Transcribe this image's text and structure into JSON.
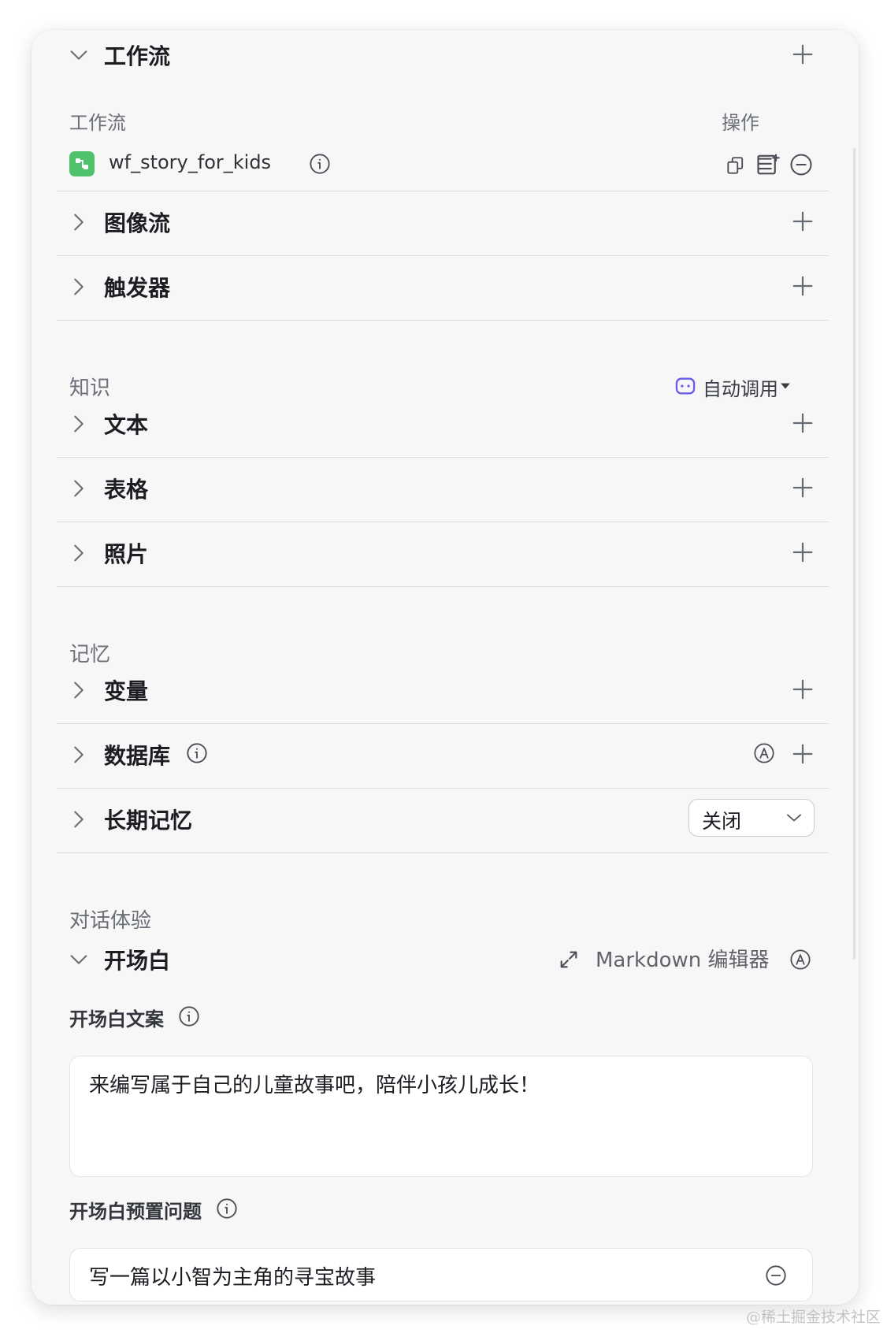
{
  "workflow": {
    "title": "工作流",
    "col_workflow": "工作流",
    "col_actions": "操作",
    "item_name": "wf_story_for_kids"
  },
  "image_flow": {
    "title": "图像流"
  },
  "trigger": {
    "title": "触发器"
  },
  "knowledge": {
    "label": "知识",
    "auto_call": "自动调用",
    "text": "文本",
    "table": "表格",
    "photo": "照片"
  },
  "memory": {
    "label": "记忆",
    "variable": "变量",
    "database": "数据库",
    "long_term": "长期记忆",
    "long_term_value": "关闭"
  },
  "dialog": {
    "label": "对话体验",
    "opening": "开场白",
    "markdown_editor": "Markdown 编辑器",
    "opening_text_label": "开场白文案",
    "opening_text": "来编写属于自己的儿童故事吧，陪伴小孩儿成长！",
    "preset_label": "开场白预置问题",
    "preset_question": "写一篇以小智为主角的寻宝故事"
  },
  "watermark": "@稀土掘金技术社区",
  "colors": {
    "accent": "#6a5ce8",
    "workflow_icon": "#4fc26b",
    "panel_bg": "#f7f7f7"
  },
  "icons": [
    "chevron-down-icon",
    "chevron-right-icon",
    "plus-icon",
    "info-icon",
    "copy-icon",
    "add-to-list-icon",
    "remove-icon",
    "bot-icon",
    "caret-down-icon",
    "auto-icon",
    "expand-icon"
  ]
}
